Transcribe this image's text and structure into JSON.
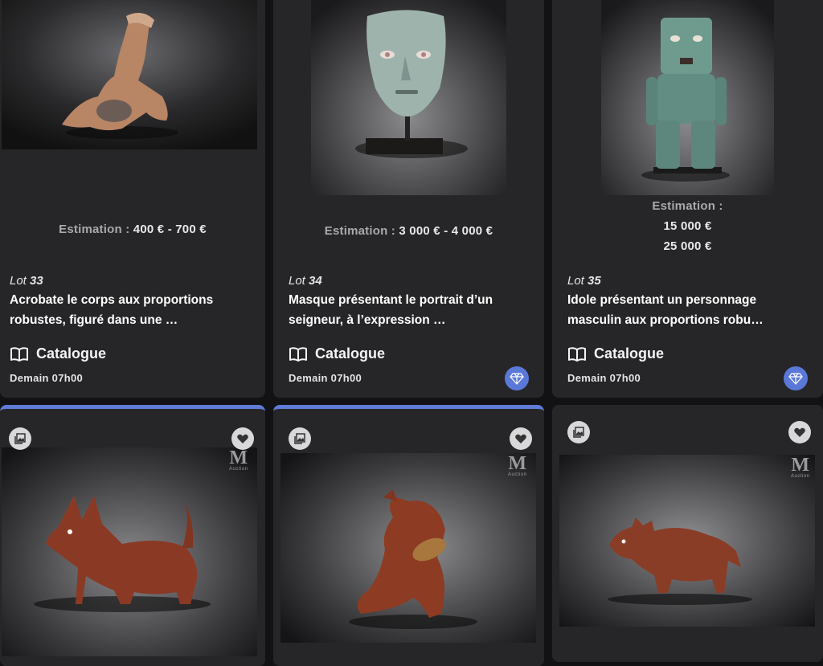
{
  "lots": [
    {
      "estimate_label": "Estimation :",
      "estimate_value": "400 € - 700 €",
      "lot_prefix": "Lot",
      "lot_number": "33",
      "title_line1": "Acrobate le corps aux proportions",
      "title_line2": "robustes, figuré dans une …",
      "catalogue_label": "Catalogue",
      "date": "Demain 07h00"
    },
    {
      "estimate_label": "Estimation :",
      "estimate_value": "3 000 € - 4 000 €",
      "lot_prefix": "Lot",
      "lot_number": "34",
      "title_line1": "Masque présentant le portrait d’un",
      "title_line2": "seigneur, à l’expression …",
      "catalogue_label": "Catalogue",
      "date": "Demain 07h00"
    },
    {
      "estimate_label": "Estimation :",
      "estimate_low": "15 000 €",
      "estimate_high": "25 000 €",
      "lot_prefix": "Lot",
      "lot_number": "35",
      "title_line1": "Idole présentant un personnage",
      "title_line2": "masculin aux proportions robu…",
      "catalogue_label": "Catalogue",
      "date": "Demain 07h00"
    }
  ],
  "watermark": {
    "letter": "M",
    "text": "Auction"
  },
  "icons": {
    "catalogue": "open-book-icon",
    "gem": "diamond-icon",
    "gallery": "image-gallery-icon",
    "favorite": "heart-icon"
  },
  "colors": {
    "background": "#121214",
    "card": "#262628",
    "accent": "#5e7bd6",
    "muted_text": "#a9a9ae"
  }
}
